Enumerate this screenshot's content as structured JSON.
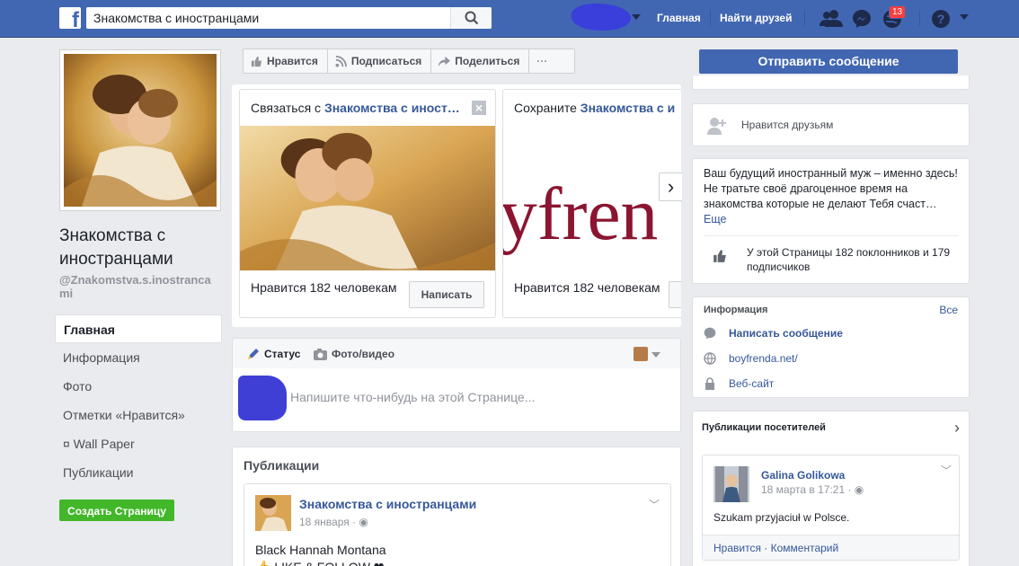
{
  "topbar": {
    "logo": "f",
    "search_value": "Знакомства с иностранцами",
    "nav_home": "Главная",
    "nav_find_friends": "Найти друзей",
    "notifications_count": "13"
  },
  "left": {
    "page_name": "Знакомства с иностранцами",
    "handle": "@Znakomstva.s.inostrancami",
    "nav": [
      {
        "label": "Главная"
      },
      {
        "label": "Информация"
      },
      {
        "label": "Фото"
      },
      {
        "label": "Отметки «Нравится»"
      },
      {
        "label": "¤ Wall Paper"
      },
      {
        "label": "Публикации"
      }
    ],
    "create_page": "Создать Страницу"
  },
  "actions": {
    "like": "Нравится",
    "subscribe": "Подписаться",
    "share": "Поделиться",
    "more": "···"
  },
  "suggestions": [
    {
      "prefix": "Связаться с ",
      "page": "Знакомства с иност…",
      "close": "×",
      "likes": "Нравится 182 человекам",
      "button": "Написать"
    },
    {
      "prefix": "Сохраните ",
      "page": "Знакомства с и",
      "image_text": "yfren",
      "likes": "Нравится 182 человекам",
      "button": "Н"
    }
  ],
  "composer": {
    "tab_status": "Статус",
    "tab_photo": "Фото/видео",
    "placeholder": "Напишите что-нибудь на этой Странице..."
  },
  "publications": {
    "title": "Публикации",
    "post": {
      "author": "Знакомства с иностранцами",
      "date": "18 января · ",
      "text_line1": "Black Hannah Montana",
      "text_line2": "👍 LIKE & FOLLOW ❤"
    }
  },
  "right": {
    "send_message": "Отправить сообщение",
    "friends_like": "Нравится друзьям",
    "about": "Ваш будущий иностранный муж – именно здесь! Не тратьте своё драгоценное время на знакомства которые не делают Тебя счаст…",
    "about_more": "Еще",
    "fans": "У этой Страницы 182 поклонников и 179 подписчиков",
    "info": {
      "title": "Информация",
      "all": "Все",
      "send_message": "Написать сообщение",
      "website": "boyfrenda.net/",
      "website_label": "Веб-сайт"
    },
    "visitors": {
      "title": "Публикации посетителей",
      "name": "Galina Golikowa",
      "date": "18 марта в 17:21 · ",
      "text": "Szukam przyjaciuł w Polsce.",
      "foot": "Нравится · Комментарий"
    }
  },
  "colors": {
    "brand": "#4267b2",
    "link": "#365899",
    "green": "#42b72a",
    "badge": "#fa3e3e"
  }
}
